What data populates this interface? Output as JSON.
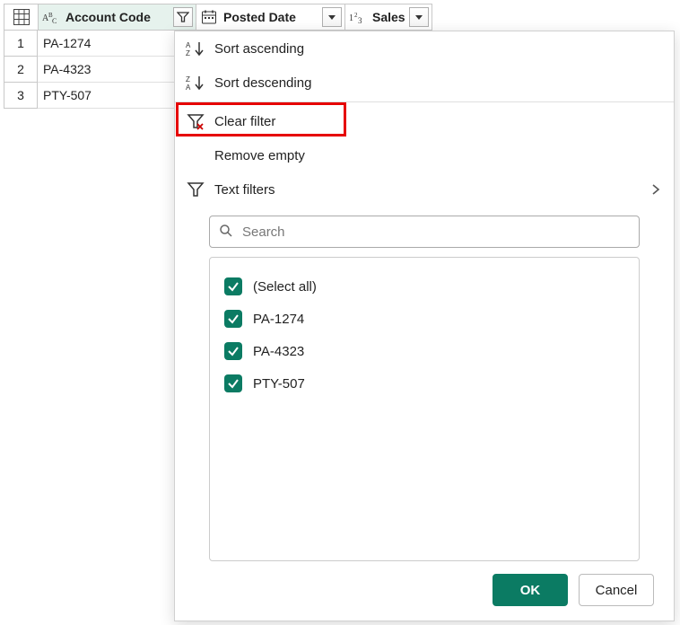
{
  "table": {
    "columns": [
      {
        "label": "Account Code",
        "type": "text",
        "filtered": true
      },
      {
        "label": "Posted Date",
        "type": "date",
        "filtered": false
      },
      {
        "label": "Sales",
        "type": "number",
        "filtered": false
      }
    ],
    "rows": [
      {
        "num": "1",
        "account_code": "PA-1274"
      },
      {
        "num": "2",
        "account_code": "PA-4323"
      },
      {
        "num": "3",
        "account_code": "PTY-507"
      }
    ]
  },
  "menu": {
    "sort_asc": "Sort ascending",
    "sort_desc": "Sort descending",
    "clear_filter": "Clear filter",
    "remove_empty": "Remove empty",
    "text_filters": "Text filters",
    "search_placeholder": "Search",
    "items": [
      {
        "label": "(Select all)",
        "checked": true
      },
      {
        "label": "PA-1274",
        "checked": true
      },
      {
        "label": "PA-4323",
        "checked": true
      },
      {
        "label": "PTY-507",
        "checked": true
      }
    ],
    "ok": "OK",
    "cancel": "Cancel"
  }
}
